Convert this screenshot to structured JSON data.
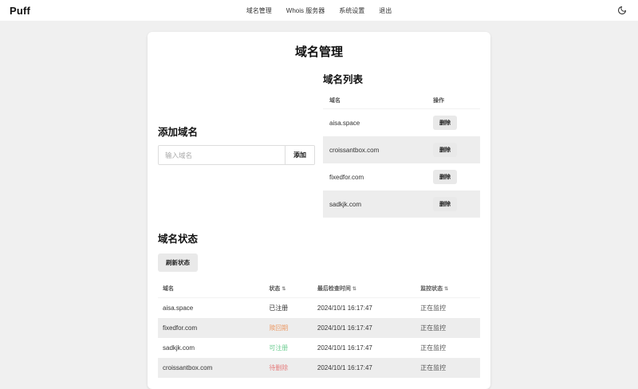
{
  "navbar": {
    "brand": "Puff",
    "links": [
      {
        "label": "域名管理"
      },
      {
        "label": "Whois 服务器"
      },
      {
        "label": "系统设置"
      },
      {
        "label": "退出"
      }
    ],
    "theme_toggle_icon": "moon-icon"
  },
  "page": {
    "title": "域名管理"
  },
  "domain_list": {
    "heading": "域名列表",
    "columns": {
      "domain": "域名",
      "action": "操作"
    },
    "delete_label": "删除",
    "rows": [
      {
        "domain": "aisa.space"
      },
      {
        "domain": "croissantbox.com"
      },
      {
        "domain": "fixedfor.com"
      },
      {
        "domain": "sadkjk.com"
      }
    ]
  },
  "add_domain": {
    "heading": "添加域名",
    "input_placeholder": "输入域名",
    "input_value": "",
    "submit_label": "添加"
  },
  "domain_status": {
    "heading": "域名状态",
    "refresh_label": "刷新状态",
    "sort_icon": "⇅",
    "columns": {
      "domain": "域名",
      "status": "状态",
      "checked_at": "最后检查时间",
      "monitor": "监控状态"
    },
    "rows": [
      {
        "domain": "aisa.space",
        "status": "已注册",
        "status_color": "#333333",
        "checked_at": "2024/10/1 16:17:47",
        "monitor": "正在监控"
      },
      {
        "domain": "fixedfor.com",
        "status": "赎回期",
        "status_color": "#eb9a66",
        "checked_at": "2024/10/1 16:17:47",
        "monitor": "正在监控"
      },
      {
        "domain": "sadkjk.com",
        "status": "可注册",
        "status_color": "#6fce93",
        "checked_at": "2024/10/1 16:17:47",
        "monitor": "正在监控"
      },
      {
        "domain": "croissantbox.com",
        "status": "待删除",
        "status_color": "#e57d7d",
        "checked_at": "2024/10/1 16:17:47",
        "monitor": "正在监控"
      }
    ]
  },
  "colors": {
    "page_background": "#f0f0f0",
    "card_background": "#ffffff",
    "zebra_row": "#ededed",
    "status_registered": "#333333",
    "status_redemption": "#eb9a66",
    "status_available": "#6fce93",
    "status_pending_delete": "#e57d7d"
  }
}
